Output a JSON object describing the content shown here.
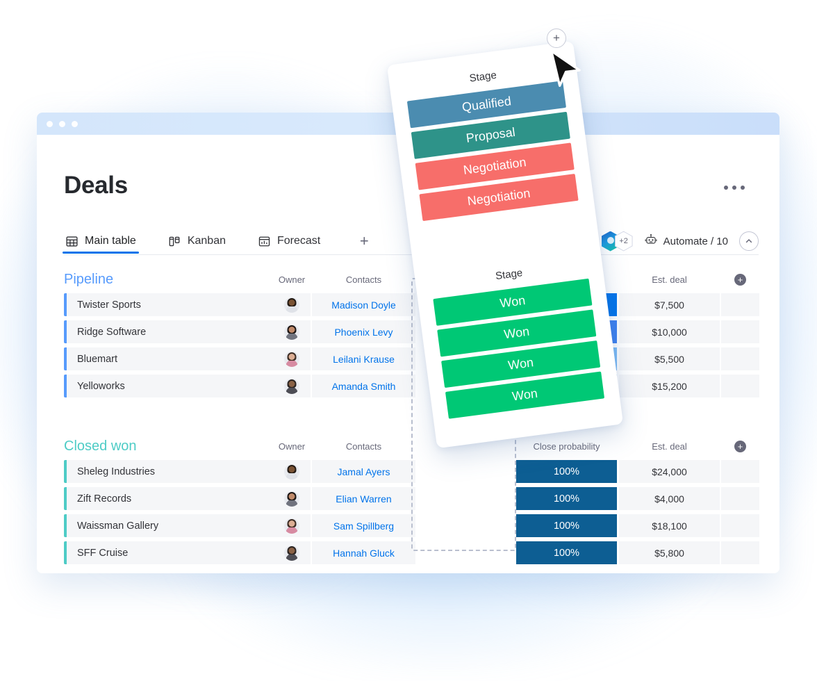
{
  "window": {
    "title_dots": 3
  },
  "header": {
    "page_title": "Deals",
    "more_label": "…"
  },
  "tabs": [
    {
      "label": "Main table",
      "icon": "table-icon",
      "active": true
    },
    {
      "label": "Kanban",
      "icon": "kanban-icon",
      "active": false
    },
    {
      "label": "Forecast",
      "icon": "forecast-chart-icon",
      "active": false
    }
  ],
  "tab_add_label": "+",
  "topright": {
    "avatar_overflow": "+2",
    "automate_label": "Automate / 10",
    "collapse_label": "⌃"
  },
  "columns": {
    "owner": "Owner",
    "contacts": "Contacts",
    "close_probability": "Close probability",
    "est_deal": "Est. deal",
    "add_column": "+"
  },
  "groups": [
    {
      "name": "Pipeline",
      "color": "#579bfc",
      "rows": [
        {
          "name": "Twister Sports",
          "contact": "Madison Doyle",
          "prob_color": "#0073ea",
          "est_deal": "$7,500"
        },
        {
          "name": "Ridge Software",
          "contact": "Phoenix Levy",
          "prob_color": "#3d80f0",
          "est_deal": "$10,000"
        },
        {
          "name": "Bluemart",
          "contact": "Leilani Krause",
          "prob_color": "#7cbcf7",
          "est_deal": "$5,500"
        },
        {
          "name": "Yelloworks",
          "contact": "Amanda Smith",
          "prob_color": "#0077c8",
          "est_deal": "$15,200"
        }
      ]
    },
    {
      "name": "Closed won",
      "color": "#4eccc6",
      "rows": [
        {
          "name": "Sheleg Industries",
          "contact": "Jamal Ayers",
          "probability": "100%",
          "prob_color": "#0d5e93",
          "est_deal": "$24,000"
        },
        {
          "name": "Zift Records",
          "contact": "Elian Warren",
          "probability": "100%",
          "prob_color": "#0d5e93",
          "est_deal": "$4,000"
        },
        {
          "name": "Waissman Gallery",
          "contact": "Sam Spillberg",
          "probability": "100%",
          "prob_color": "#0d5e93",
          "est_deal": "$18,100"
        },
        {
          "name": "SFF Cruise",
          "contact": "Hannah Gluck",
          "probability": "100%",
          "prob_color": "#0d5e93",
          "est_deal": "$5,800"
        }
      ]
    }
  ],
  "dragged_card": {
    "add_button_label": "+",
    "groups": [
      {
        "column_label": "Stage",
        "chips": [
          {
            "label": "Qualified",
            "color": "#4b8cb0"
          },
          {
            "label": "Proposal",
            "color": "#2e9389"
          },
          {
            "label": "Negotiation",
            "color": "#f76e6a"
          },
          {
            "label": "Negotiation",
            "color": "#f76e6a"
          }
        ]
      },
      {
        "column_label": "Stage",
        "chips": [
          {
            "label": "Won",
            "color": "#00c875"
          },
          {
            "label": "Won",
            "color": "#00c875"
          },
          {
            "label": "Won",
            "color": "#00c875"
          },
          {
            "label": "Won",
            "color": "#00c875"
          }
        ]
      }
    ]
  },
  "palette": {
    "accent_blue": "#0073ea",
    "pipeline": "#579bfc",
    "closed_won": "#4eccc6",
    "won_green": "#00c875",
    "negotiation_red": "#f76e6a",
    "row_bg": "#f5f6f8"
  },
  "avatar_styles": [
    {
      "skin": "#6b4a34",
      "hair": "#241a14",
      "shirt": "#e3e5ea"
    },
    {
      "skin": "#b7apple",
      "hair": "#1b1412",
      "shirt": "#6e7380"
    },
    {
      "skin": "#d9a98f",
      "hair": "#3a2a22",
      "shirt": "#d58ba0"
    },
    {
      "skin": "#7a5a42",
      "hair": "#2a2320",
      "shirt": "#4b4b52"
    }
  ]
}
